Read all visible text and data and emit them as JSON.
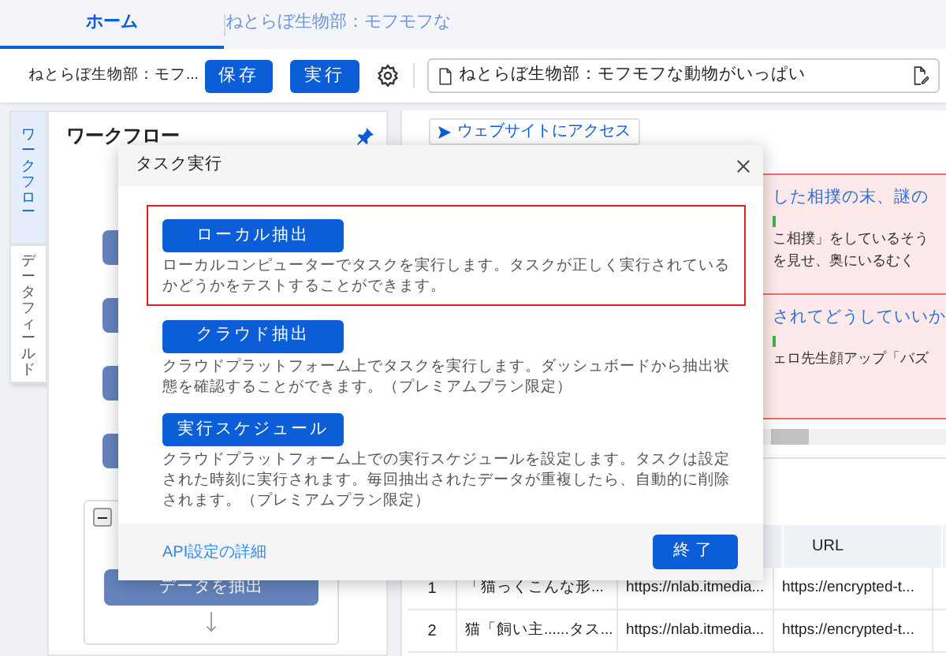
{
  "tabs": [
    {
      "label": "ホーム",
      "selected": true
    },
    {
      "label": "ねとらぼ生物部：モフモフな",
      "selected": false
    }
  ],
  "toolbar": {
    "task_name": "ねとらぼ生物部：モフ...",
    "save": "保存",
    "run": "実行",
    "url": "ねとらぼ生物部：モフモフな動物がいっぱい"
  },
  "side_tabs": [
    {
      "label": "ワークフロー",
      "selected": true
    },
    {
      "label": "データフィールド",
      "selected": false
    }
  ],
  "workflow": {
    "title": "ワークフロー",
    "loop_expanded": true,
    "extract_step": "データを抽出"
  },
  "browser": {
    "action": "ウェブサイトにアクセス",
    "results": [
      {
        "title": "した相撲の末、謎の",
        "lines": [
          "こ相撲」をしているそう",
          "を見せ、奥にいるむく"
        ]
      },
      {
        "title": "されてどうしていいか",
        "lines": [
          "ェロ先生顔アップ「バズ"
        ]
      }
    ]
  },
  "table": {
    "columns": [
      "",
      "",
      "",
      "URL"
    ],
    "rows": [
      {
        "cells": [
          "1",
          "「猫っくこんな形...",
          "https://nlab.itmedia...",
          "https://encrypted-t..."
        ]
      },
      {
        "cells": [
          "2",
          "猫「飼い主......タス...",
          "https://nlab.itmedia...",
          "https://encrypted-t..."
        ]
      }
    ]
  },
  "dialog": {
    "title": "タスク実行",
    "options": [
      {
        "label": "ローカル抽出",
        "description": "ローカルコンピューターでタスクを実行します。タスクが正しく実行されているかどうかをテストすることができます。",
        "selected": true
      },
      {
        "label": "クラウド抽出",
        "description": "クラウドプラットフォーム上でタスクを実行します。ダッシュボードから抽出状態を確認することができます。（プレミアムプラン限定）",
        "selected": false
      },
      {
        "label": "実行スケジュール",
        "description": "クラウドプラットフォーム上での実行スケジュールを設定します。タスクは設定された時刻に実行されます。毎回抽出されたデータが重複したら、自動的に削除されます。（プレミアムプラン限定）",
        "selected": false
      }
    ],
    "api_link": "API設定の詳細",
    "finish": "終了"
  }
}
